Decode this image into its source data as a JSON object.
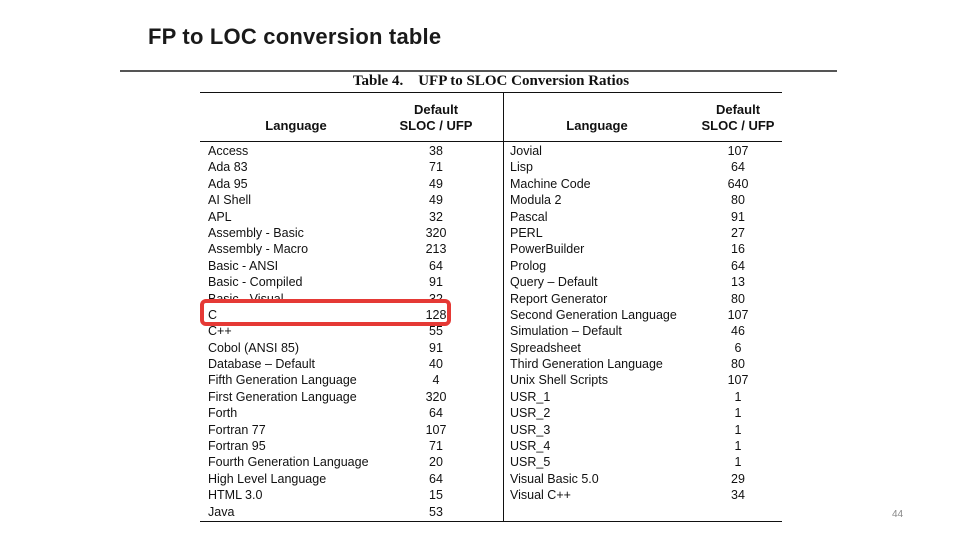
{
  "slide": {
    "title": "FP to LOC conversion table",
    "page_number": "44"
  },
  "table": {
    "caption": "Table 4.    UFP to SLOC Conversion Ratios",
    "headers": {
      "language": "Language",
      "default_line1": "Default",
      "default_line2": "SLOC / UFP"
    },
    "left": [
      {
        "language": "Access",
        "value": "38"
      },
      {
        "language": "Ada 83",
        "value": "71"
      },
      {
        "language": "Ada 95",
        "value": "49"
      },
      {
        "language": "AI Shell",
        "value": "49"
      },
      {
        "language": "APL",
        "value": "32"
      },
      {
        "language": "Assembly - Basic",
        "value": "320"
      },
      {
        "language": "Assembly - Macro",
        "value": "213"
      },
      {
        "language": "Basic - ANSI",
        "value": "64"
      },
      {
        "language": "Basic - Compiled",
        "value": "91"
      },
      {
        "language": "Basic - Visual",
        "value": "32"
      },
      {
        "language": "C",
        "value": "128"
      },
      {
        "language": "C++",
        "value": "55"
      },
      {
        "language": "Cobol (ANSI 85)",
        "value": "91"
      },
      {
        "language": "Database – Default",
        "value": "40"
      },
      {
        "language": "Fifth Generation Language",
        "value": "4"
      },
      {
        "language": "First Generation Language",
        "value": "320"
      },
      {
        "language": "Forth",
        "value": "64"
      },
      {
        "language": "Fortran 77",
        "value": "107"
      },
      {
        "language": "Fortran 95",
        "value": "71"
      },
      {
        "language": "Fourth Generation Language",
        "value": "20"
      },
      {
        "language": "High Level Language",
        "value": "64"
      },
      {
        "language": "HTML 3.0",
        "value": "15"
      },
      {
        "language": "Java",
        "value": "53"
      }
    ],
    "right": [
      {
        "language": "Jovial",
        "value": "107"
      },
      {
        "language": "Lisp",
        "value": "64"
      },
      {
        "language": "Machine Code",
        "value": "640"
      },
      {
        "language": "Modula 2",
        "value": "80"
      },
      {
        "language": "Pascal",
        "value": "91"
      },
      {
        "language": "PERL",
        "value": "27"
      },
      {
        "language": "PowerBuilder",
        "value": "16"
      },
      {
        "language": "Prolog",
        "value": "64"
      },
      {
        "language": "Query – Default",
        "value": "13"
      },
      {
        "language": "Report Generator",
        "value": "80"
      },
      {
        "language": "Second Generation Language",
        "value": "107"
      },
      {
        "language": "Simulation – Default",
        "value": "46"
      },
      {
        "language": "Spreadsheet",
        "value": "6"
      },
      {
        "language": "Third Generation Language",
        "value": "80"
      },
      {
        "language": "Unix Shell Scripts",
        "value": "107"
      },
      {
        "language": "USR_1",
        "value": "1"
      },
      {
        "language": "USR_2",
        "value": "1"
      },
      {
        "language": "USR_3",
        "value": "1"
      },
      {
        "language": "USR_4",
        "value": "1"
      },
      {
        "language": "USR_5",
        "value": "1"
      },
      {
        "language": "Visual Basic 5.0",
        "value": "29"
      },
      {
        "language": "Visual C++",
        "value": "34"
      }
    ],
    "highlighted_row": "C",
    "highlight_color": "#e53935"
  }
}
